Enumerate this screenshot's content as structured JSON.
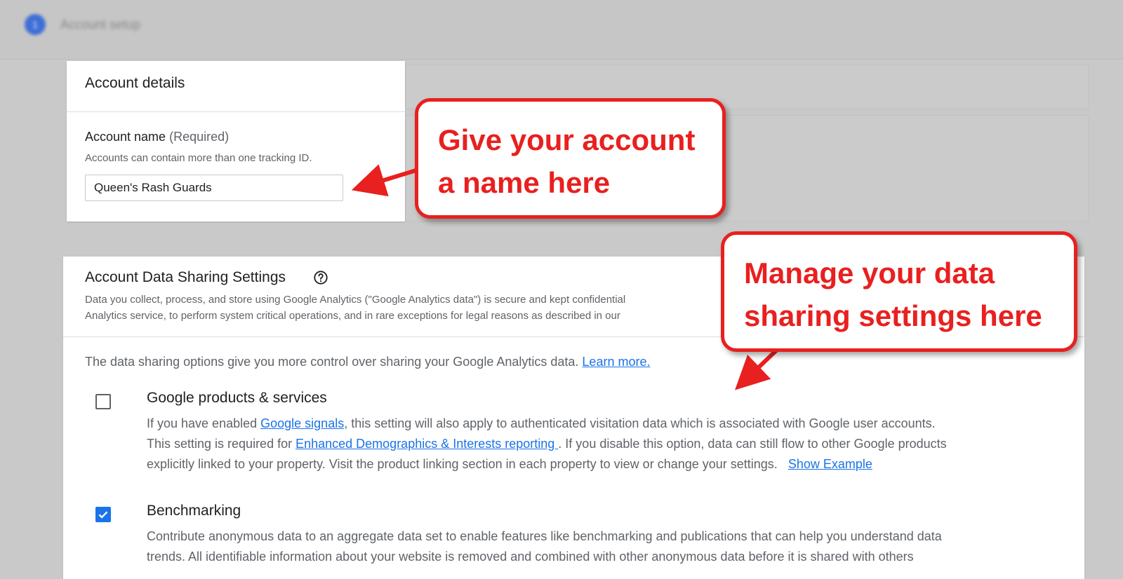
{
  "header": {
    "step_number": "1",
    "step_title": "Account setup"
  },
  "account_details": {
    "title": "Account details",
    "name_label": "Account name",
    "name_required": "(Required)",
    "name_hint": "Accounts can contain more than one tracking ID.",
    "name_value": "Queen's Rash Guards"
  },
  "data_sharing": {
    "title": "Account Data Sharing Settings",
    "help_icon": "help-circle-icon",
    "description_line1": "Data you collect, process, and store using Google Analytics (\"Google Analytics data\") is secure and kept confidential",
    "description_line2": "Analytics service, to perform system critical operations, and in rare exceptions for legal reasons as described in our",
    "intro_text": "The data sharing options give you more control over sharing your Google Analytics data.",
    "learn_more": "Learn more.",
    "options": [
      {
        "title": "Google products & services",
        "checked": false,
        "line1_pre": "If you have enabled ",
        "line1_link": "Google signals",
        "line1_post": ", this setting will also apply to authenticated visitation data which is associated with Google user accounts.",
        "line2_pre": "This setting is required for ",
        "line2_link": "Enhanced Demographics & Interests reporting ",
        "line2_post": ". If you disable this option, data can still flow to other Google products",
        "line3": "explicitly linked to your property. Visit the product linking section in each property to view or change your settings.",
        "show_example": "Show Example"
      },
      {
        "title": "Benchmarking",
        "checked": true,
        "line1": "Contribute anonymous data to an aggregate data set to enable features like benchmarking and publications that can help you understand data",
        "line2": "trends. All identifiable information about your website is removed and combined with other anonymous data before it is shared with others"
      }
    ]
  },
  "callouts": {
    "account_name": [
      "Give your account",
      "a name here"
    ],
    "data_sharing": [
      "Manage your data",
      "sharing settings here"
    ]
  },
  "colors": {
    "callout_red": "#e8201f",
    "link_blue": "#1a73e8",
    "checkbox_blue": "#1a73e8"
  }
}
